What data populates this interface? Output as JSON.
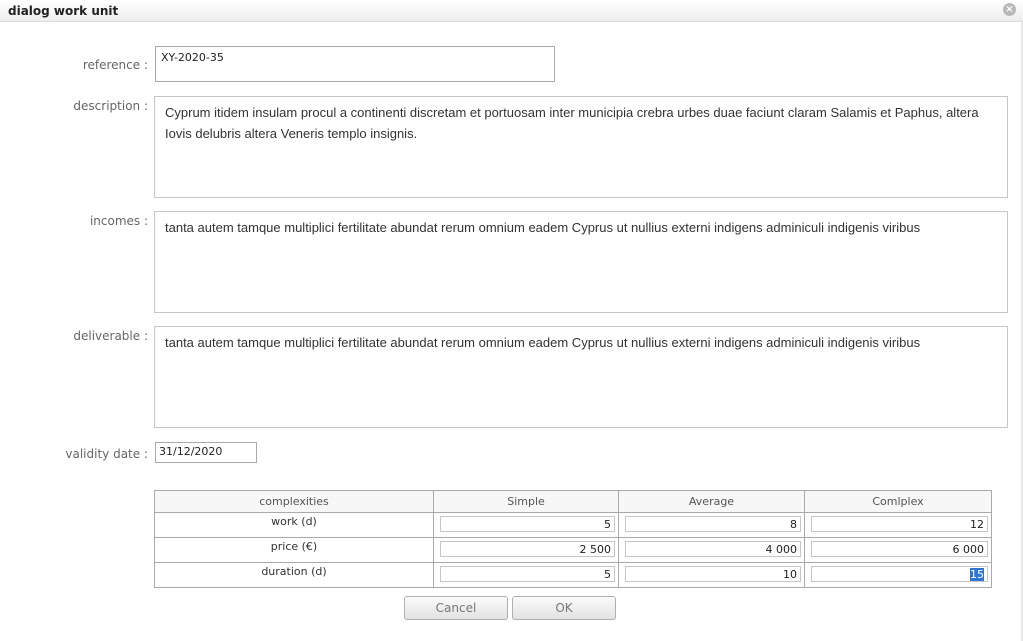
{
  "dialog": {
    "title": "dialog work unit"
  },
  "form": {
    "reference": {
      "label": "reference :",
      "value": "XY-2020-35"
    },
    "description": {
      "label": "description :",
      "value": "Cyprum itidem insulam procul a continenti discretam et portuosam inter municipia crebra urbes duae faciunt claram Salamis et Paphus, altera Iovis delubris altera Veneris templo insignis."
    },
    "incomes": {
      "label": "incomes :",
      "value": "tanta autem tamque multiplici fertilitate abundat rerum omnium eadem Cyprus ut nullius externi indigens adminiculi indigenis viribus"
    },
    "deliverable": {
      "label": "deliverable :",
      "value": "tanta autem tamque multiplici fertilitate abundat rerum omnium eadem Cyprus ut nullius externi indigens adminiculi indigenis viribus"
    },
    "validity_date": {
      "label": "validity date :",
      "value": "31/12/2020"
    }
  },
  "complexities": {
    "headers": [
      "complexities",
      "Simple",
      "Average",
      "Comlplex"
    ],
    "rows": [
      {
        "label": "work (d)",
        "values": [
          "5",
          "8",
          "12"
        ]
      },
      {
        "label": "price (€)",
        "values": [
          "2 500",
          "4 000",
          "6 000"
        ]
      },
      {
        "label": "duration (d)",
        "values": [
          "5",
          "10",
          "15"
        ]
      }
    ]
  },
  "buttons": {
    "cancel": "Cancel",
    "ok": "OK"
  },
  "colors": {
    "selection": "#3075d0",
    "border": "#aaaaaa",
    "label": "#666666"
  }
}
